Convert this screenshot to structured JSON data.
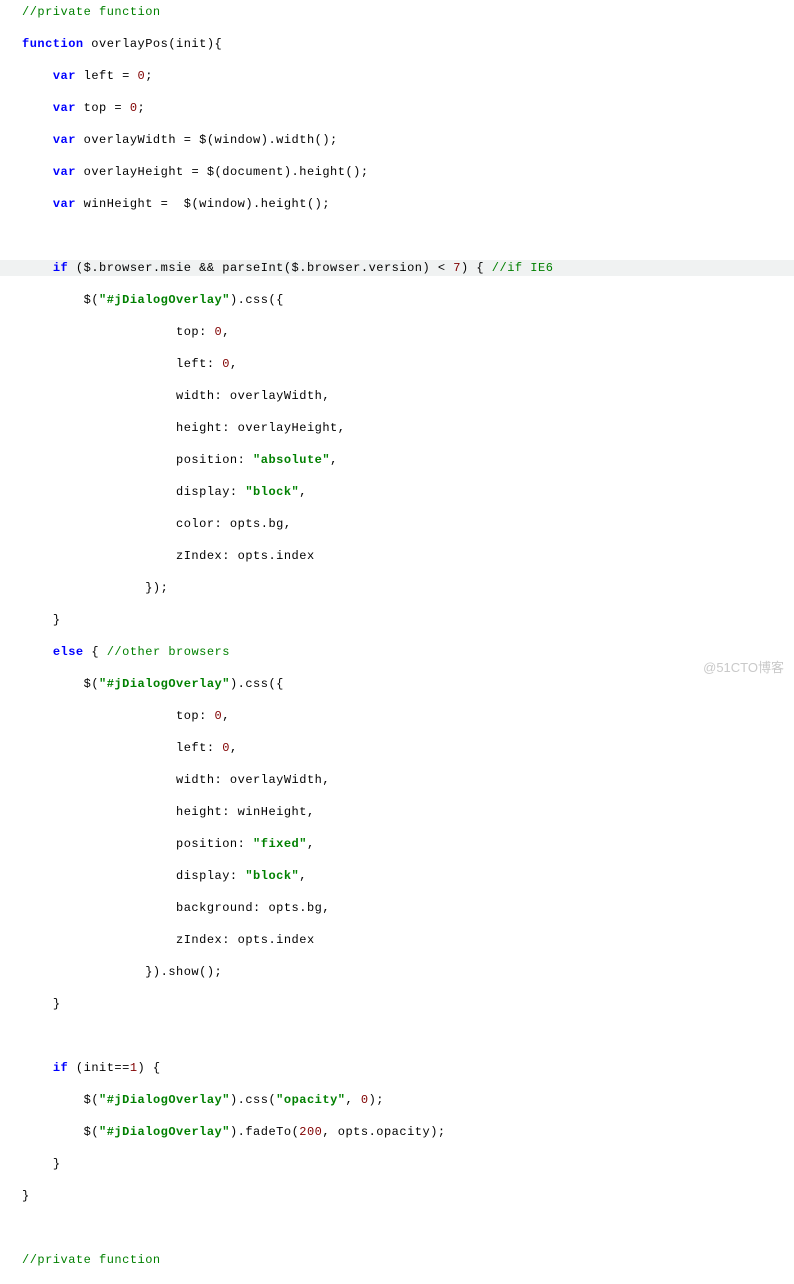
{
  "watermark": "@51CTO博客",
  "code": {
    "comments": {
      "privateFn": "//private function",
      "ifIE6": "//if IE6",
      "otherBrowsers": "//other browsers"
    },
    "keywords": {
      "function": "function",
      "var": "var",
      "if": "if",
      "else": "else"
    },
    "numbers": {
      "zero": "0",
      "one": "1",
      "seven": "7",
      "twoHundred": "200"
    },
    "strings": {
      "selector": "\"#jDialogOverlay\"",
      "absolute": "\"absolute\"",
      "block": "\"block\"",
      "fixed": "\"fixed\"",
      "opacity": "\"opacity\""
    },
    "plain": {
      "fnDecl": " overlayPos(init){",
      "leftDecl": " left = ",
      "semi": ";",
      "topDecl": " top = ",
      "owDecl": " overlayWidth = $(window).width();",
      "ohDecl": " overlayHeight = $(document).height();",
      "whDecl": " winHeight =  $(window).height();",
      "ifCond1": " ($.browser.msie && parseInt($.browser.version) < ",
      "ifCond2": ") { ",
      "cssCall1": "    $(",
      "cssCall2": ").css({",
      "cssTop": "                    top: ",
      "comma": ",",
      "cssLeft": "                    left: ",
      "cssWidth": "                    width: overlayWidth,",
      "cssHeightOH": "                    height: overlayHeight,",
      "cssHeightWH": "                    height: winHeight,",
      "cssPosition": "                    position: ",
      "cssDisplay": "                    display: ",
      "cssColor": "                    color: opts.bg,",
      "cssBackground": "                    background: opts.bg,",
      "cssZindex": "                    zIndex: opts.index",
      "closeObj1": "                });",
      "closeObj2": "                }).show();",
      "closeBrace": "}",
      "elseOpen": " { ",
      "ifInit1": " (init==",
      "ifInit2": ") {",
      "jq1": "    $(",
      "cssOp1": ").css(",
      "cssOp2": ", ",
      "cssOp3": ");",
      "fadeTo1": ").fadeTo(",
      "fadeTo2": ", opts.opacity);"
    }
  }
}
